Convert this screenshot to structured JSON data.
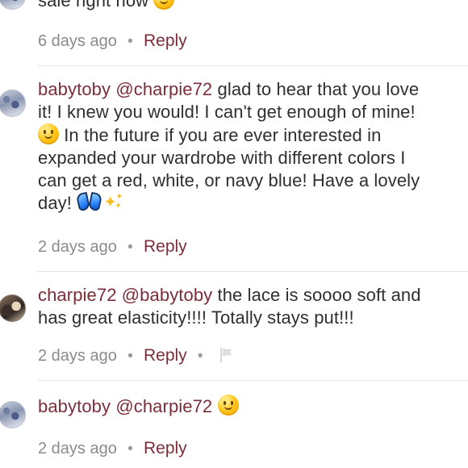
{
  "comments": [
    {
      "username": "",
      "mention": "",
      "text_lines": [
        "sale right now"
      ],
      "emojis": [
        "smiling-face-icon"
      ],
      "time": "6 days ago",
      "reply": "Reply"
    },
    {
      "username": "babytoby",
      "mention": "@charpie72",
      "text_lines": [
        "glad to hear that you love",
        "it! I knew you would! I can't get enough of mine!",
        "In the future if you are ever interested in",
        "expanded your wardrobe with different colors I",
        "can get a red, white, or navy blue! Have a lovely",
        "day!"
      ],
      "emojis": [
        "smiling-face-icon",
        "blue-butterfly-icon",
        "sparkles-icon"
      ],
      "time": "2 days ago",
      "reply": "Reply"
    },
    {
      "username": "charpie72",
      "mention": "@babytoby",
      "text_lines": [
        "the lace is soooo soft and",
        "has great elasticity!!!!  Totally stays put!!!"
      ],
      "emojis": [],
      "time": "2 days ago",
      "reply": "Reply",
      "flag": "flag-icon"
    },
    {
      "username": "babytoby",
      "mention": "@charpie72",
      "text_lines": [],
      "emojis": [
        "smiling-face-icon"
      ],
      "time": "2 days ago",
      "reply": "Reply"
    }
  ],
  "colors": {
    "accent": "#7b2d3a",
    "text": "#2f2f2f",
    "muted": "#8b8b8b",
    "divider": "#e2e2e2"
  }
}
